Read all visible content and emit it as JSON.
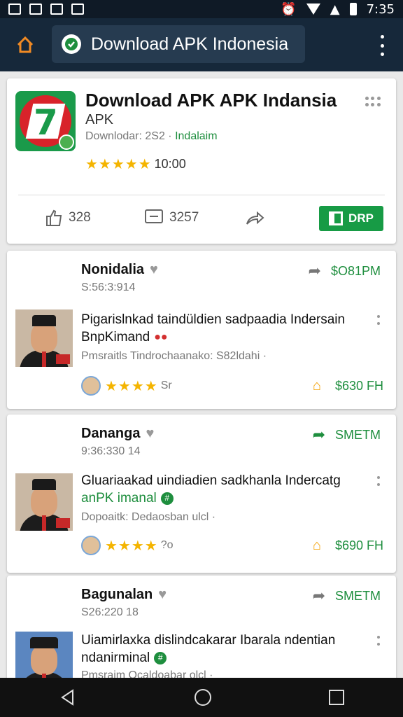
{
  "status_bar": {
    "time": "7:35",
    "icons": [
      "image-icon",
      "gallery-icon",
      "photo-icon",
      "video-icon",
      "alarm-icon",
      "wifi-icon",
      "signal-icon",
      "battery-icon"
    ]
  },
  "toolbar": {
    "title": "Download APK Indonesia",
    "home_icon": "home-icon",
    "menu_icon": "more-vert-icon"
  },
  "app": {
    "title": "Download APK APK Indansia",
    "subtitle": "APK",
    "downloads": "Downlodar: 2S2",
    "separator": "·",
    "category": "Indalaim",
    "stars": "★★★★★",
    "rating": "10:00",
    "likes": "328",
    "comments": "3257",
    "download_label": "DRP"
  },
  "posts": [
    {
      "name": "Nonidalia",
      "time": "S:56:3:914",
      "share_price": "$O81PM",
      "text_line1": "Pigarislnkad taindüldien sadpaadia Indersain",
      "text_line2": "BnpKimand",
      "emoji": "●●",
      "info": "Pmsraitls Tindrochaanako: S82ldahi  ·",
      "stars": "★★★★",
      "rating_suffix": "Sr",
      "price": "$630 FH"
    },
    {
      "name": "Dananga",
      "time": "9:36:330 14",
      "share_price": "SMETM",
      "text_line1": "Gluariaakad uindiadien sadkhanla Indercatg",
      "text_line2": "anPK imanal",
      "emoji": "",
      "info": "Dopoaitk: Dedaosban ulcl  ·",
      "stars": "★★★★",
      "rating_suffix": "?o",
      "price": "$690 FH"
    },
    {
      "name": "Bagunalan",
      "time": "S26:220 18",
      "share_price": "SMETM",
      "text_line1": "Uiamirlaxka dislindcakarar Ibarala ndentian",
      "text_line2": "ndanirminal",
      "emoji": "",
      "info": "Pmsraim Ocaldoabar olcl  ·",
      "stars": "",
      "rating_suffix": "",
      "price": ""
    }
  ],
  "colors": {
    "toolbar_bg": "#16283a",
    "accent_green": "#179b45",
    "star_yellow": "#f4b400"
  }
}
